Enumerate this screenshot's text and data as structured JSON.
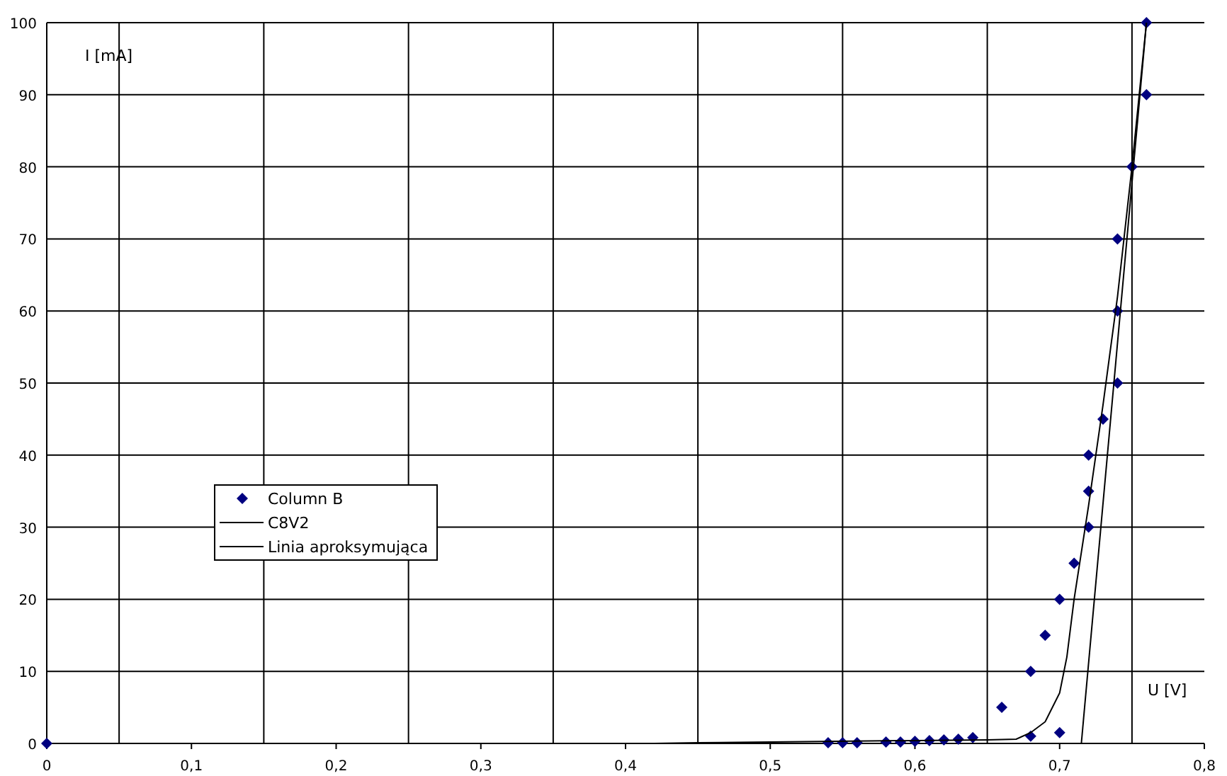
{
  "chart_data": {
    "type": "scatter",
    "grid": true,
    "legend": true,
    "xlabel": "U [V]",
    "ylabel": "I [mA]",
    "xlim": [
      0,
      0.8
    ],
    "ylim": [
      0,
      100
    ],
    "xticks": [
      {
        "value": 0,
        "label": "0"
      },
      {
        "value": 0.1,
        "label": "0,1"
      },
      {
        "value": 0.2,
        "label": "0,2"
      },
      {
        "value": 0.3,
        "label": "0,3"
      },
      {
        "value": 0.4,
        "label": "0,4"
      },
      {
        "value": 0.5,
        "label": "0,5"
      },
      {
        "value": 0.6,
        "label": "0,6"
      },
      {
        "value": 0.7,
        "label": "0,7"
      },
      {
        "value": 0.8,
        "label": "0,8"
      }
    ],
    "yticks": [
      0,
      10,
      20,
      30,
      40,
      50,
      60,
      70,
      80,
      90,
      100
    ],
    "series": [
      {
        "name": "Column B",
        "type": "scatter",
        "color": "#000080",
        "x": [
          0,
          0.54,
          0.55,
          0.56,
          0.58,
          0.59,
          0.6,
          0.61,
          0.62,
          0.63,
          0.64,
          0.66,
          0.68,
          0.68,
          0.69,
          0.7,
          0.7,
          0.71,
          0.72,
          0.72,
          0.72,
          0.73,
          0.74,
          0.74,
          0.74,
          0.75,
          0.76,
          0.76
        ],
        "values": [
          0,
          0.1,
          0.1,
          0.1,
          0.2,
          0.2,
          0.3,
          0.4,
          0.5,
          0.6,
          0.8,
          5,
          1,
          10,
          15,
          1.5,
          20,
          25,
          30,
          35,
          40,
          45,
          50,
          60,
          70,
          80,
          90,
          100
        ]
      },
      {
        "name": "C8V2",
        "type": "line",
        "color": "#000000",
        "x": [
          0.42,
          0.45,
          0.5,
          0.6,
          0.65,
          0.67,
          0.68,
          0.69,
          0.7,
          0.705,
          0.71,
          0.72,
          0.73,
          0.74,
          0.75,
          0.76
        ],
        "values": [
          0,
          0.1,
          0.2,
          0.4,
          0.5,
          0.6,
          1.5,
          3,
          7,
          12,
          20,
          33,
          47,
          62,
          80,
          100
        ]
      },
      {
        "name": "Linia aproksymująca",
        "type": "line",
        "color": "#000000",
        "x": [
          0.715,
          0.76
        ],
        "values": [
          0,
          100
        ]
      }
    ]
  }
}
